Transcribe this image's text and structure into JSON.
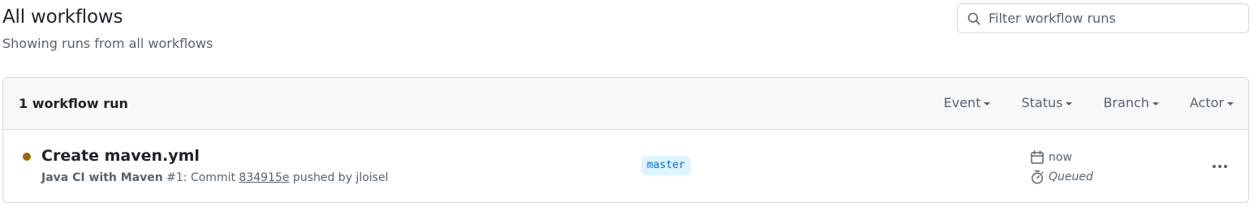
{
  "header": {
    "title": "All workflows",
    "subtitle": "Showing runs from all workflows"
  },
  "search": {
    "placeholder": "Filter workflow runs",
    "value": "",
    "icon": "search-icon"
  },
  "runs_list": {
    "count_label": "1 workflow run",
    "filters": [
      {
        "label": "Event"
      },
      {
        "label": "Status"
      },
      {
        "label": "Branch"
      },
      {
        "label": "Actor"
      }
    ],
    "runs": [
      {
        "status": "queued",
        "status_color": "#9a6700",
        "title": "Create maven.yml",
        "workflow_name": "Java CI with Maven",
        "run_number": "#1",
        "commit_prefix": ": Commit ",
        "commit_sha": "834915e",
        "pushed_by": " pushed by jloisel",
        "branch": "master",
        "time": "now",
        "duration": "Queued"
      }
    ]
  },
  "colors": {
    "accent": "#0969da",
    "branch_bg": "#ddf4ff",
    "muted_text": "#59636e",
    "border": "#d1d9e0"
  }
}
